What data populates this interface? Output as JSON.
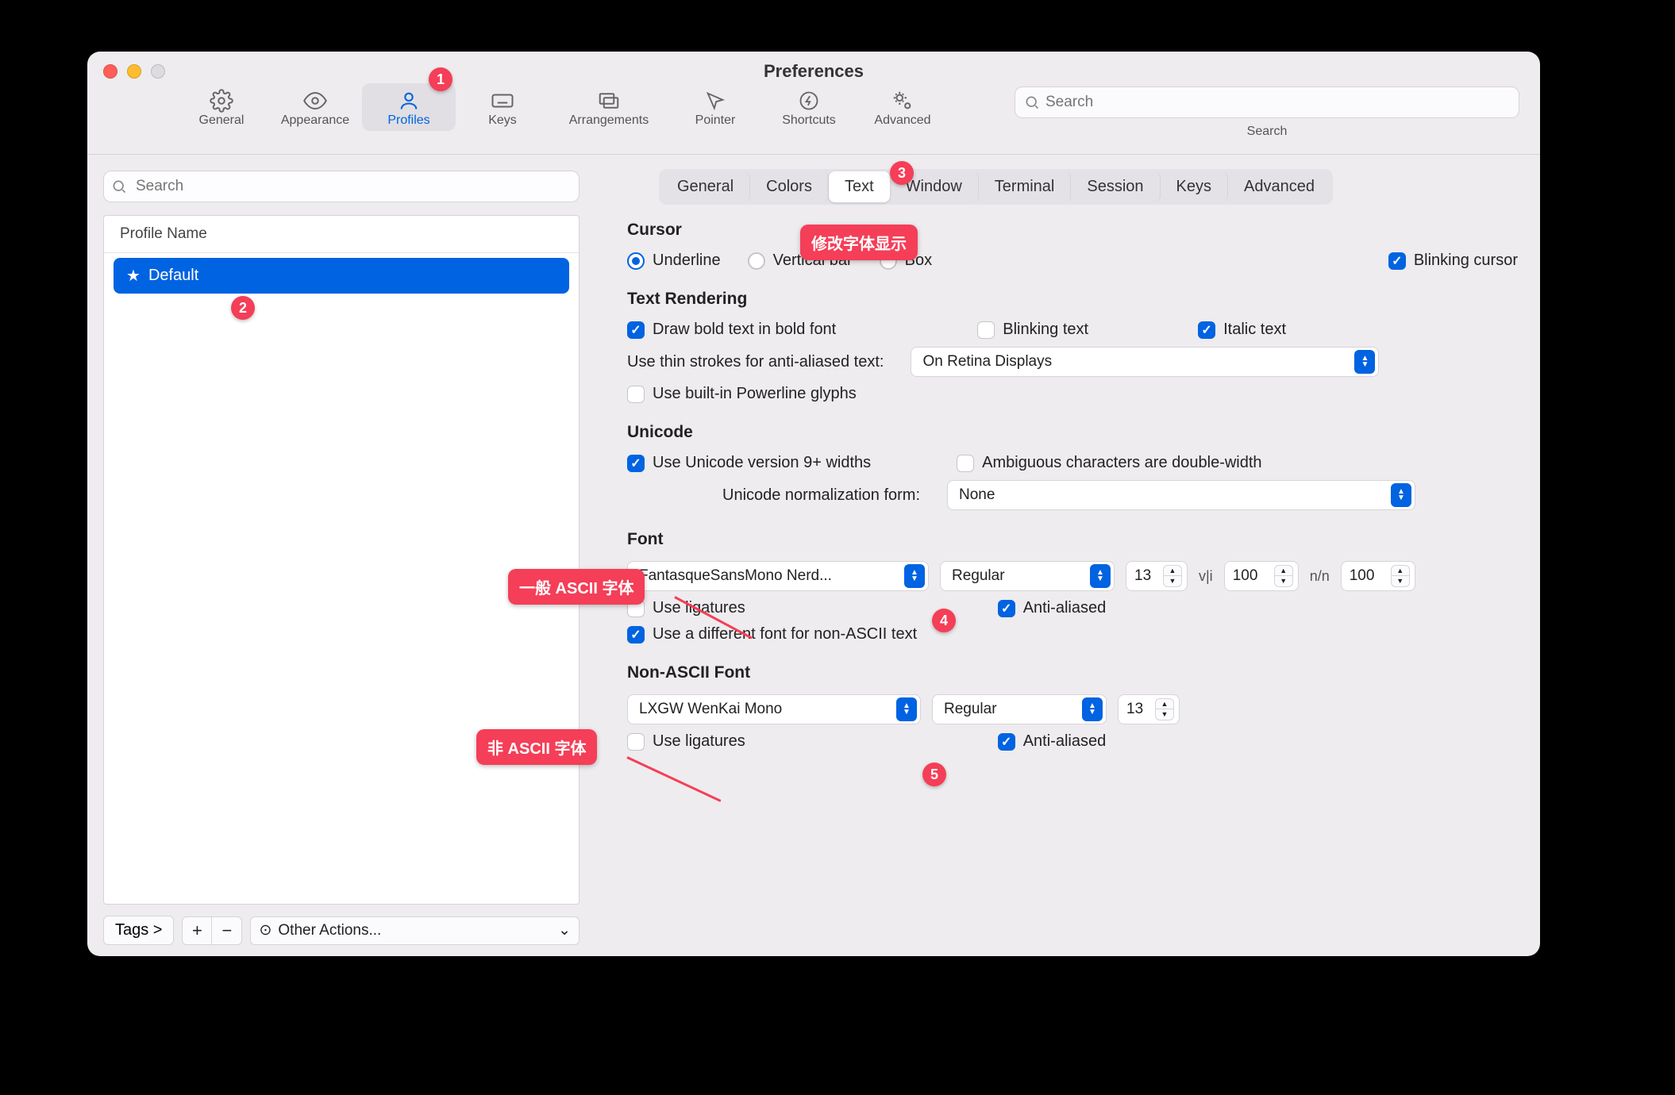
{
  "title": "Preferences",
  "toolbar": {
    "items": [
      {
        "label": "General"
      },
      {
        "label": "Appearance"
      },
      {
        "label": "Profiles"
      },
      {
        "label": "Keys"
      },
      {
        "label": "Arrangements"
      },
      {
        "label": "Pointer"
      },
      {
        "label": "Shortcuts"
      },
      {
        "label": "Advanced"
      }
    ],
    "search_placeholder": "Search",
    "search_label": "Search"
  },
  "sidebar": {
    "search_placeholder": "Search",
    "header": "Profile Name",
    "profile_name": "Default",
    "tags_btn": "Tags >",
    "other_actions": "Other Actions..."
  },
  "tabs": [
    "General",
    "Colors",
    "Text",
    "Window",
    "Terminal",
    "Session",
    "Keys",
    "Advanced"
  ],
  "cursor": {
    "heading": "Cursor",
    "underline": "Underline",
    "vertical": "Vertical bar",
    "box": "Box",
    "blinking": "Blinking cursor"
  },
  "text_rendering": {
    "heading": "Text Rendering",
    "bold": "Draw bold text in bold font",
    "blinking_text": "Blinking text",
    "italic": "Italic text",
    "thin_label": "Use thin strokes for anti-aliased text:",
    "thin_value": "On Retina Displays",
    "powerline": "Use built-in Powerline glyphs"
  },
  "unicode": {
    "heading": "Unicode",
    "v9": "Use Unicode version 9+ widths",
    "ambig": "Ambiguous characters are double-width",
    "norm_label": "Unicode normalization form:",
    "norm_value": "None"
  },
  "font": {
    "heading": "Font",
    "name": "FantasqueSansMono Nerd...",
    "weight": "Regular",
    "size": "13",
    "hspacing": "100",
    "vspacing": "100",
    "hspace_icon": "v|i",
    "vspace_icon": "n/n",
    "ligatures": "Use ligatures",
    "antialiased": "Anti-aliased",
    "diff_font": "Use a different font for non-ASCII text"
  },
  "nafont": {
    "heading": "Non-ASCII Font",
    "name": "LXGW WenKai Mono",
    "weight": "Regular",
    "size": "13",
    "ligatures": "Use ligatures",
    "antialiased": "Anti-aliased"
  },
  "annotations": {
    "b1": "1",
    "b2": "2",
    "b3": "3",
    "b4": "4",
    "b5": "5",
    "text_tab": "修改字体显示",
    "ascii_font": "一般 ASCII 字体",
    "non_ascii_font": "非 ASCII 字体"
  }
}
